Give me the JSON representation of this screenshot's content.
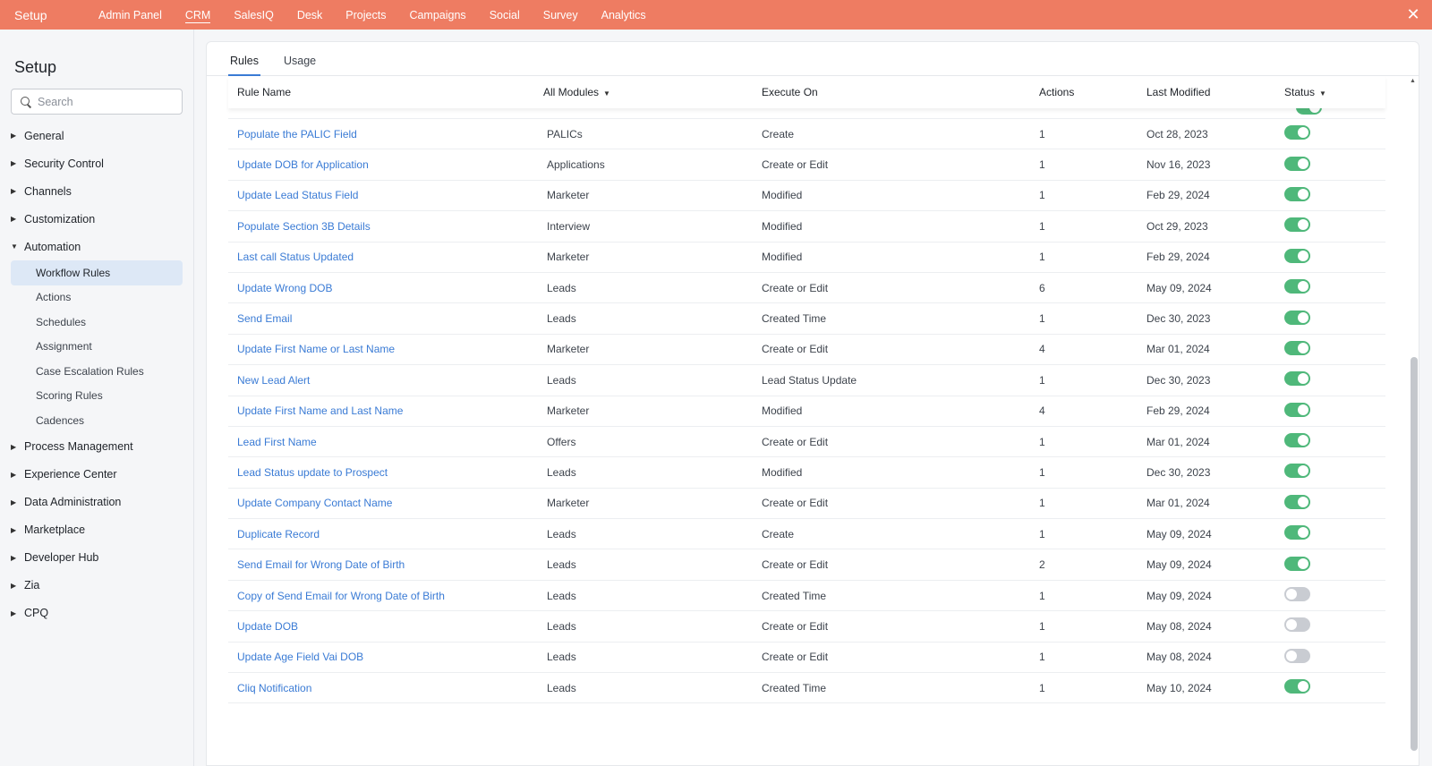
{
  "topbar": {
    "brand": "Setup",
    "nav": [
      {
        "label": "Admin Panel"
      },
      {
        "label": "CRM",
        "active": true
      },
      {
        "label": "SalesIQ"
      },
      {
        "label": "Desk"
      },
      {
        "label": "Projects"
      },
      {
        "label": "Campaigns"
      },
      {
        "label": "Social"
      },
      {
        "label": "Survey"
      },
      {
        "label": "Analytics"
      }
    ],
    "close_icon": "close-icon",
    "background": "#ee7c62"
  },
  "sidebar": {
    "title": "Setup",
    "search": {
      "placeholder": "Search",
      "value": ""
    },
    "sections": [
      {
        "label": "General",
        "expanded": false
      },
      {
        "label": "Security Control",
        "expanded": false
      },
      {
        "label": "Channels",
        "expanded": false
      },
      {
        "label": "Customization",
        "expanded": false
      },
      {
        "label": "Automation",
        "expanded": true,
        "items": [
          {
            "label": "Workflow Rules",
            "active": true
          },
          {
            "label": "Actions"
          },
          {
            "label": "Schedules"
          },
          {
            "label": "Assignment"
          },
          {
            "label": "Case Escalation Rules"
          },
          {
            "label": "Scoring Rules"
          },
          {
            "label": "Cadences"
          }
        ]
      },
      {
        "label": "Process Management",
        "expanded": false
      },
      {
        "label": "Experience Center",
        "expanded": false
      },
      {
        "label": "Data Administration",
        "expanded": false
      },
      {
        "label": "Marketplace",
        "expanded": false
      },
      {
        "label": "Developer Hub",
        "expanded": false
      },
      {
        "label": "Zia",
        "expanded": false
      },
      {
        "label": "CPQ",
        "expanded": false
      }
    ]
  },
  "main": {
    "tabs": [
      {
        "label": "Rules",
        "active": true
      },
      {
        "label": "Usage"
      }
    ],
    "table": {
      "columns": {
        "rule_name": "Rule Name",
        "modules": "All Modules",
        "execute_on": "Execute On",
        "actions": "Actions",
        "last_modified": "Last Modified",
        "status": "Status"
      },
      "partial_row_status": true,
      "rows": [
        {
          "name": "Populate the PALIC Field",
          "module": "PALICs",
          "execute_on": "Create",
          "actions": "1",
          "modified": "Oct 28, 2023",
          "status": true
        },
        {
          "name": "Update DOB for Application",
          "module": "Applications",
          "execute_on": "Create or Edit",
          "actions": "1",
          "modified": "Nov 16, 2023",
          "status": true
        },
        {
          "name": "Update Lead Status Field",
          "module": "Marketer",
          "execute_on": "Modified",
          "actions": "1",
          "modified": "Feb 29, 2024",
          "status": true
        },
        {
          "name": "Populate Section 3B Details",
          "module": "Interview",
          "execute_on": "Modified",
          "actions": "1",
          "modified": "Oct 29, 2023",
          "status": true
        },
        {
          "name": "Last call Status Updated",
          "module": "Marketer",
          "execute_on": "Modified",
          "actions": "1",
          "modified": "Feb 29, 2024",
          "status": true
        },
        {
          "name": "Update Wrong DOB",
          "module": "Leads",
          "execute_on": "Create or Edit",
          "actions": "6",
          "modified": "May 09, 2024",
          "status": true
        },
        {
          "name": "Send Email",
          "module": "Leads",
          "execute_on": "Created Time",
          "actions": "1",
          "modified": "Dec 30, 2023",
          "status": true
        },
        {
          "name": "Update First Name or Last Name",
          "module": "Marketer",
          "execute_on": "Create or Edit",
          "actions": "4",
          "modified": "Mar 01, 2024",
          "status": true
        },
        {
          "name": "New Lead Alert",
          "module": "Leads",
          "execute_on": "Lead Status Update",
          "actions": "1",
          "modified": "Dec 30, 2023",
          "status": true
        },
        {
          "name": "Update First Name and Last Name",
          "module": "Marketer",
          "execute_on": "Modified",
          "actions": "4",
          "modified": "Feb 29, 2024",
          "status": true
        },
        {
          "name": "Lead First Name",
          "module": "Offers",
          "execute_on": "Create or Edit",
          "actions": "1",
          "modified": "Mar 01, 2024",
          "status": true
        },
        {
          "name": "Lead Status update to Prospect",
          "module": "Leads",
          "execute_on": "Modified",
          "actions": "1",
          "modified": "Dec 30, 2023",
          "status": true
        },
        {
          "name": "Update Company Contact Name",
          "module": "Marketer",
          "execute_on": "Create or Edit",
          "actions": "1",
          "modified": "Mar 01, 2024",
          "status": true
        },
        {
          "name": "Duplicate Record",
          "module": "Leads",
          "execute_on": "Create",
          "actions": "1",
          "modified": "May 09, 2024",
          "status": true
        },
        {
          "name": "Send Email for Wrong Date of Birth",
          "module": "Leads",
          "execute_on": "Create or Edit",
          "actions": "2",
          "modified": "May 09, 2024",
          "status": true
        },
        {
          "name": "Copy of Send Email for Wrong Date of Birth",
          "module": "Leads",
          "execute_on": "Created Time",
          "actions": "1",
          "modified": "May 09, 2024",
          "status": false
        },
        {
          "name": "Update DOB",
          "module": "Leads",
          "execute_on": "Create or Edit",
          "actions": "1",
          "modified": "May 08, 2024",
          "status": false
        },
        {
          "name": "Update Age Field Vai DOB",
          "module": "Leads",
          "execute_on": "Create or Edit",
          "actions": "1",
          "modified": "May 08, 2024",
          "status": false
        },
        {
          "name": "Cliq Notification",
          "module": "Leads",
          "execute_on": "Created Time",
          "actions": "1",
          "modified": "May 10, 2024",
          "status": true
        }
      ]
    }
  },
  "colors": {
    "accent": "#3a7bd5",
    "toggle_on": "#4fb87a",
    "toggle_off": "#c9ccd2",
    "active_item_bg": "#dde8f6"
  }
}
